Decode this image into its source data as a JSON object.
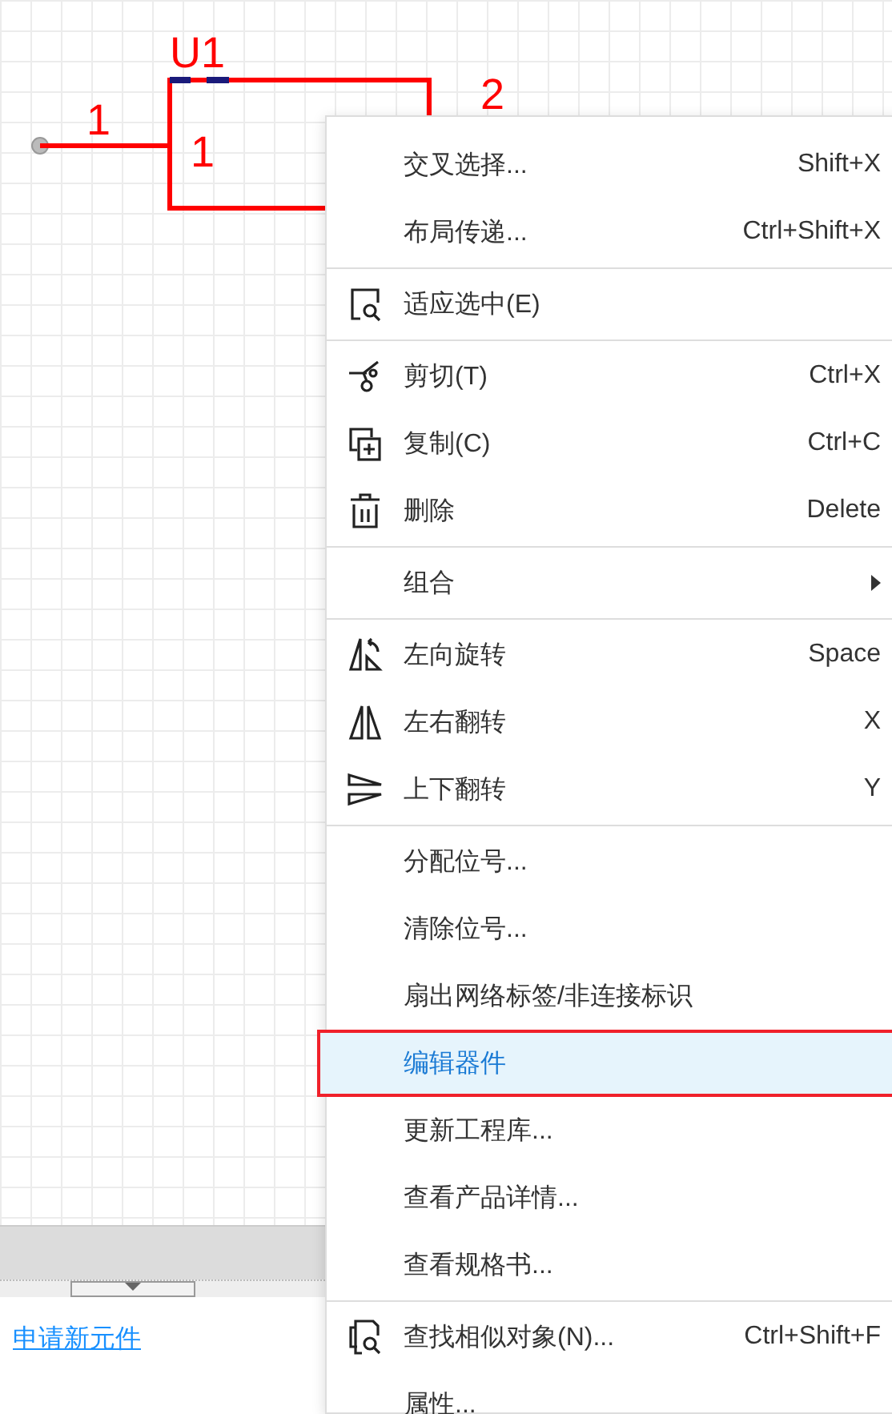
{
  "schematic": {
    "designator": "U1",
    "pin_number": "1",
    "pin_name": "1",
    "pin_number_2": "2"
  },
  "panel": {
    "link": "申请新元件"
  },
  "menu": {
    "groups": [
      {
        "items": [
          {
            "label": "交叉选择...",
            "shortcut": "Shift+X",
            "selected": false
          },
          {
            "label": "布局传递...",
            "shortcut": "Ctrl+Shift+X",
            "selected": false
          }
        ]
      },
      {
        "items": [
          {
            "label": "适应选中(E)",
            "kind": "zoom-frame",
            "selected": false
          }
        ]
      },
      {
        "items": [
          {
            "label": "剪切(T)",
            "shortcut": "Ctrl+X",
            "kind": "scissors",
            "selected": false
          },
          {
            "label": "复制(C)",
            "shortcut": "Ctrl+C",
            "kind": "copy",
            "selected": false
          },
          {
            "label": "删除",
            "shortcut": "Delete",
            "kind": "trash",
            "selected": false
          }
        ]
      },
      {
        "items": [
          {
            "label": "组合",
            "submenu": true,
            "selected": false
          }
        ]
      },
      {
        "items": [
          {
            "label": "左向旋转",
            "shortcut": "Space",
            "kind": "rotate",
            "selected": false
          },
          {
            "label": "左右翻转",
            "shortcut": "X",
            "kind": "flip-h",
            "selected": false
          },
          {
            "label": "上下翻转",
            "shortcut": "Y",
            "kind": "flip-v",
            "selected": false
          }
        ]
      },
      {
        "items": [
          {
            "label": "分配位号...",
            "selected": false
          },
          {
            "label": "清除位号...",
            "selected": false
          },
          {
            "label": "扇出网络标签/非连接标识",
            "selected": false
          },
          {
            "label": "编辑器件",
            "selected": true
          },
          {
            "label": "更新工程库...",
            "selected": false
          },
          {
            "label": "查看产品详情...",
            "selected": false
          },
          {
            "label": "查看规格书...",
            "selected": false
          }
        ]
      },
      {
        "items": [
          {
            "label": "查找相似对象(N)...",
            "shortcut": "Ctrl+Shift+F",
            "kind": "find-similar",
            "selected": false
          },
          {
            "label": "属性...",
            "selected": false
          }
        ]
      }
    ]
  }
}
